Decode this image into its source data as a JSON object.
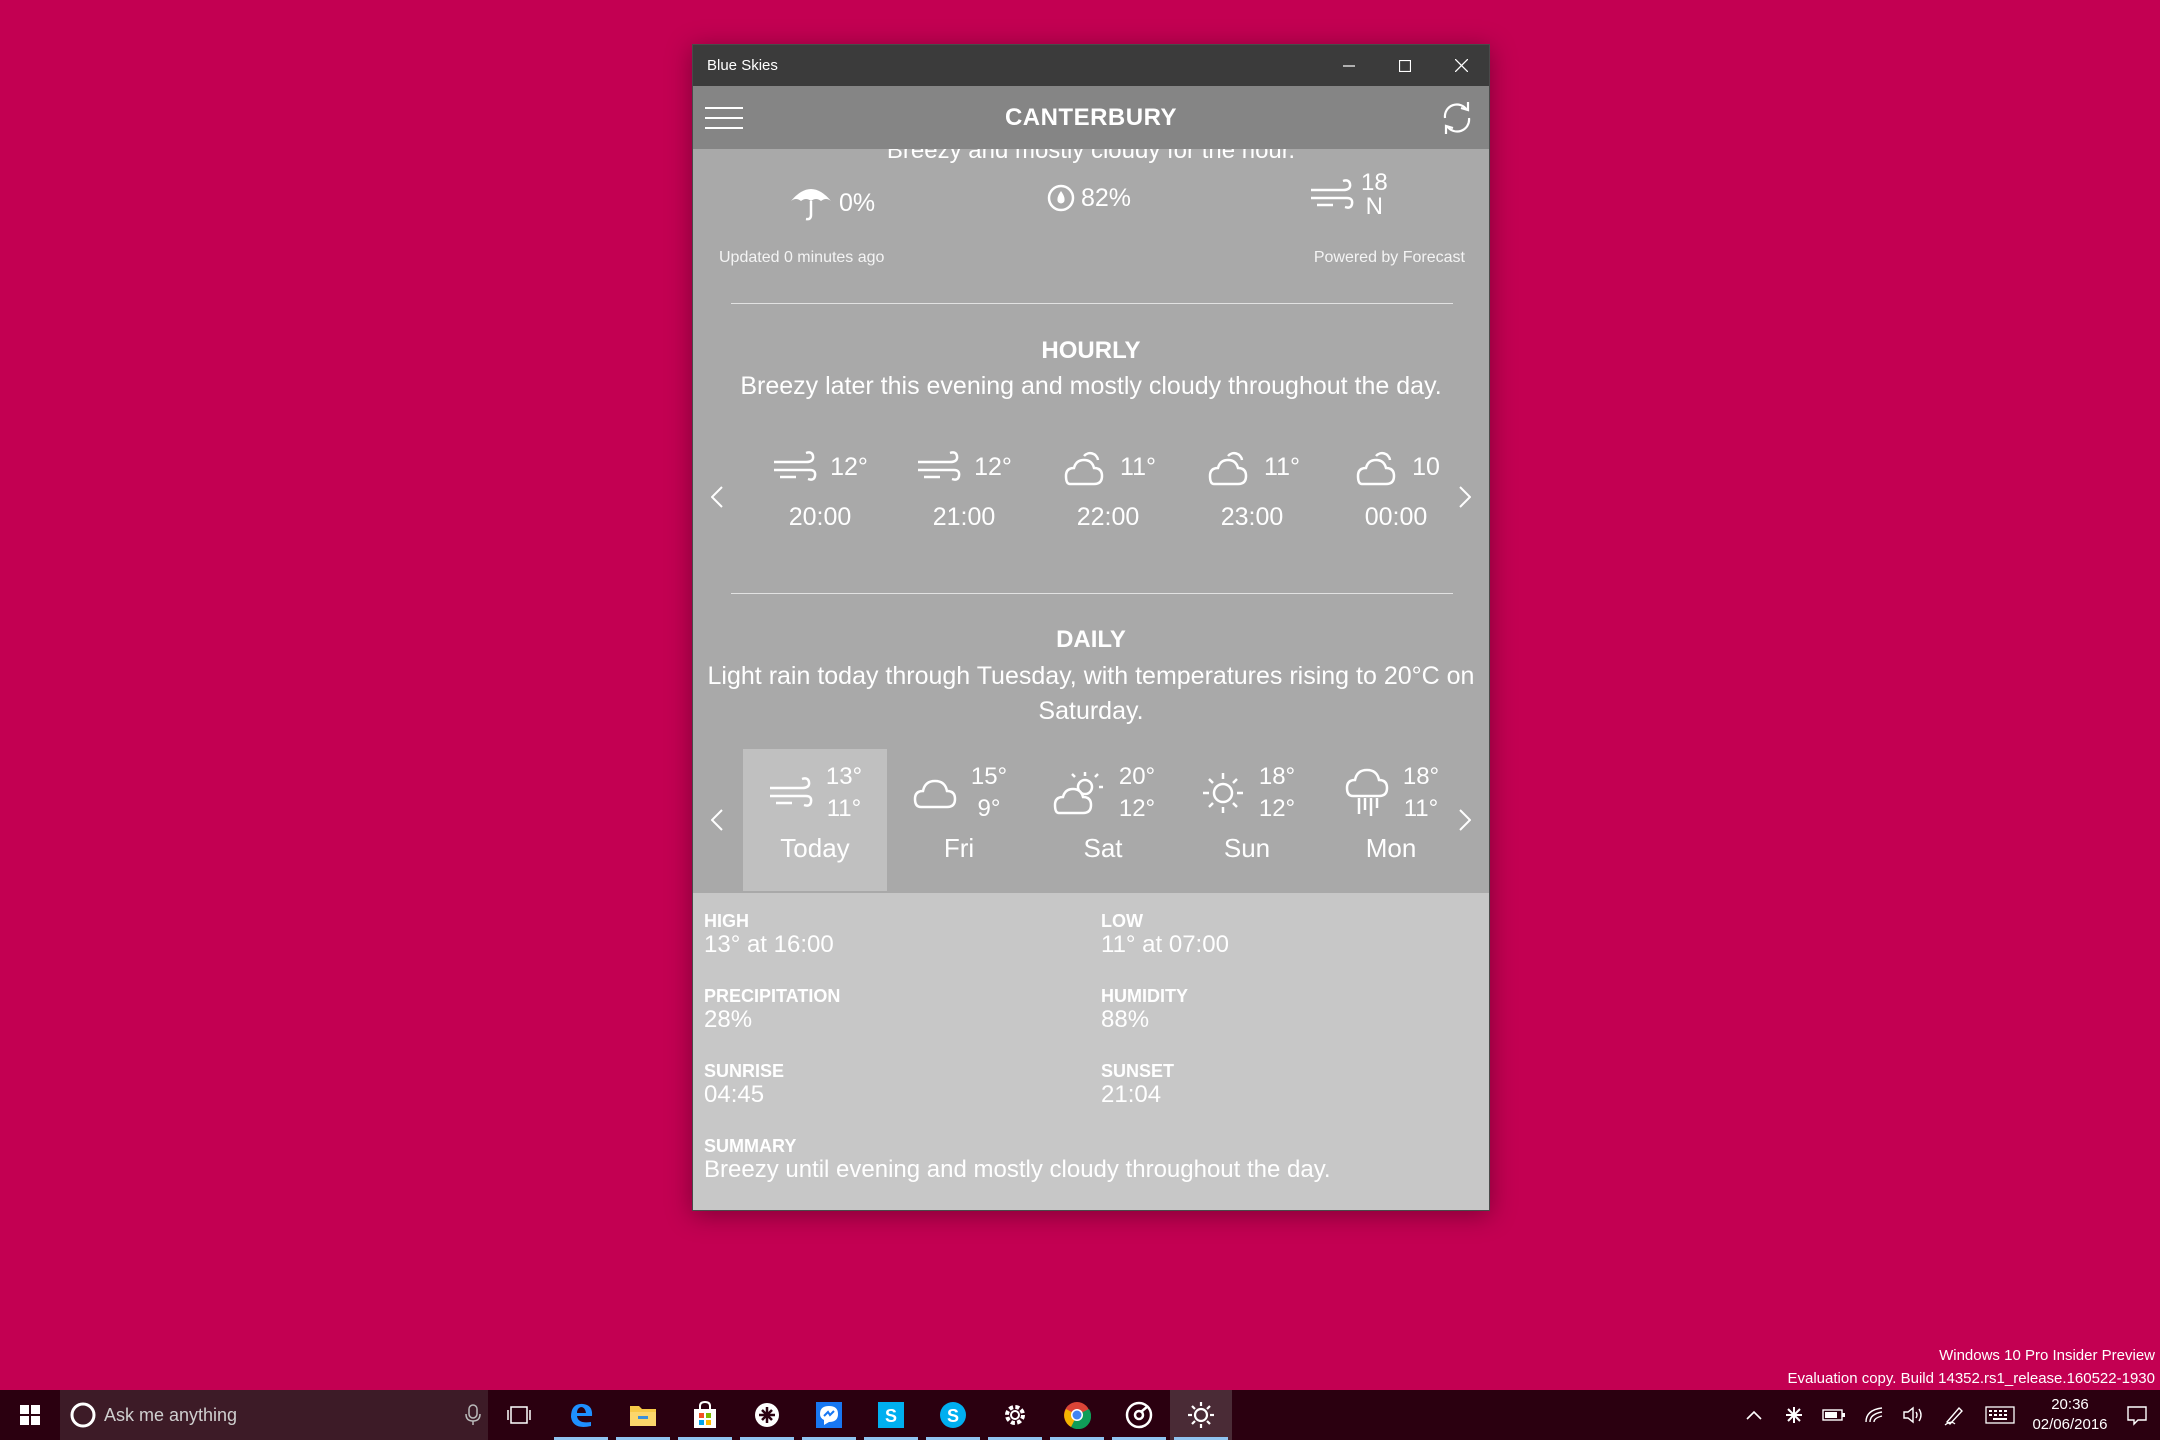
{
  "window": {
    "title": "Blue Skies",
    "controls": {
      "minimize": "minimize-icon",
      "maximize": "maximize-icon",
      "close": "close-icon"
    }
  },
  "appbar": {
    "city": "CANTERBURY",
    "menu_icon": "hamburger-icon",
    "refresh_icon": "refresh-icon"
  },
  "current": {
    "summary": "Breezy and mostly cloudy for the hour.",
    "precip": "0%",
    "humidity": "82%",
    "wind_speed": "18",
    "wind_dir": "N",
    "updated": "Updated 0 minutes ago",
    "powered": "Powered by Forecast"
  },
  "hourly": {
    "title": "HOURLY",
    "summary": "Breezy later this evening and mostly cloudy throughout the day.",
    "items": [
      {
        "icon": "wind-icon",
        "temp": "12°",
        "time": "20:00"
      },
      {
        "icon": "wind-icon",
        "temp": "12°",
        "time": "21:00"
      },
      {
        "icon": "partly-cloudy-icon",
        "temp": "11°",
        "time": "22:00"
      },
      {
        "icon": "partly-cloudy-icon",
        "temp": "11°",
        "time": "23:00"
      },
      {
        "icon": "partly-cloudy-icon",
        "temp": "10",
        "time": "00:00"
      }
    ]
  },
  "daily": {
    "title": "DAILY",
    "summary": "Light rain today through Tuesday, with temperatures rising to 20°C on Saturday.",
    "items": [
      {
        "icon": "wind-icon",
        "high": "13°",
        "low": "11°",
        "day": "Today",
        "selected": true
      },
      {
        "icon": "cloud-icon",
        "high": "15°",
        "low": "9°",
        "day": "Fri"
      },
      {
        "icon": "partly-sunny-icon",
        "high": "20°",
        "low": "12°",
        "day": "Sat"
      },
      {
        "icon": "sun-icon",
        "high": "18°",
        "low": "12°",
        "day": "Sun"
      },
      {
        "icon": "rain-icon",
        "high": "18°",
        "low": "11°",
        "day": "Mon"
      }
    ]
  },
  "details": {
    "high_label": "HIGH",
    "high_value": "13° at 16:00",
    "low_label": "LOW",
    "low_value": "11° at 07:00",
    "precip_label": "PRECIPITATION",
    "precip_value": "28%",
    "humidity_label": "HUMIDITY",
    "humidity_value": "88%",
    "sunrise_label": "SUNRISE",
    "sunrise_value": "04:45",
    "sunset_label": "SUNSET",
    "sunset_value": "21:04",
    "summary_label": "SUMMARY",
    "summary_value": "Breezy until evening and mostly cloudy throughout the day."
  },
  "watermark": {
    "line1": "Windows 10 Pro Insider Preview",
    "line2": "Evaluation copy. Build 14352.rs1_release.160522-1930"
  },
  "taskbar": {
    "search_placeholder": "Ask me anything",
    "apps": [
      "task-view-icon",
      "edge-icon",
      "file-explorer-icon",
      "store-icon",
      "app-icon",
      "messenger-icon",
      "skype-icon",
      "skype-icon",
      "settings-icon",
      "chrome-icon",
      "groove-icon",
      "weather-icon"
    ],
    "time": "20:36",
    "date": "02/06/2016"
  },
  "colors": {
    "desktop": "#c30052",
    "app_bg": "#a9a9a9",
    "appbar": "#858585",
    "titlebar": "#3b3b3b",
    "taskbar": "#2b0010"
  }
}
